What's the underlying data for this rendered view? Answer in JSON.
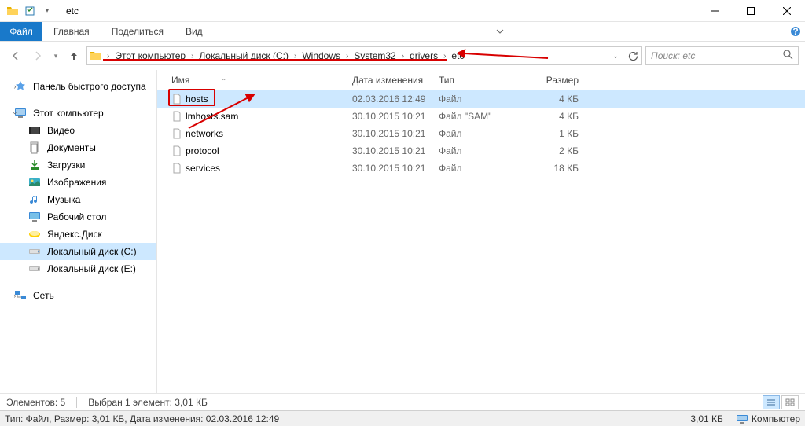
{
  "window": {
    "title": "etc"
  },
  "ribbon": {
    "file": "Файл",
    "tabs": [
      "Главная",
      "Поделиться",
      "Вид"
    ]
  },
  "breadcrumb": [
    "Этот компьютер",
    "Локальный диск (C:)",
    "Windows",
    "System32",
    "drivers",
    "etc"
  ],
  "search": {
    "placeholder": "Поиск: etc"
  },
  "sidebar": {
    "quick": "Панель быстрого доступа",
    "thispc": "Этот компьютер",
    "items": [
      {
        "label": "Видео"
      },
      {
        "label": "Документы"
      },
      {
        "label": "Загрузки"
      },
      {
        "label": "Изображения"
      },
      {
        "label": "Музыка"
      },
      {
        "label": "Рабочий стол"
      },
      {
        "label": "Яндекс.Диск"
      },
      {
        "label": "Локальный диск (C:)"
      },
      {
        "label": "Локальный диск (E:)"
      }
    ],
    "network": "Сеть"
  },
  "columns": {
    "name": "Имя",
    "date": "Дата изменения",
    "type": "Тип",
    "size": "Размер"
  },
  "files": [
    {
      "name": "hosts",
      "date": "02.03.2016 12:49",
      "type": "Файл",
      "size": "4 КБ"
    },
    {
      "name": "lmhosts.sam",
      "date": "30.10.2015 10:21",
      "type": "Файл \"SAM\"",
      "size": "4 КБ"
    },
    {
      "name": "networks",
      "date": "30.10.2015 10:21",
      "type": "Файл",
      "size": "1 КБ"
    },
    {
      "name": "protocol",
      "date": "30.10.2015 10:21",
      "type": "Файл",
      "size": "2 КБ"
    },
    {
      "name": "services",
      "date": "30.10.2015 10:21",
      "type": "Файл",
      "size": "18 КБ"
    }
  ],
  "status1": {
    "elements": "Элементов: 5",
    "selected": "Выбран 1 элемент: 3,01 КБ"
  },
  "status2": {
    "info": "Тип: Файл, Размер: 3,01 КБ, Дата изменения: 02.03.2016 12:49",
    "size": "3,01 КБ",
    "computer": "Компьютер"
  }
}
